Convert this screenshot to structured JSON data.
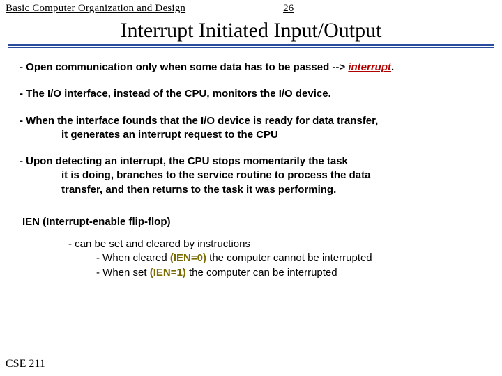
{
  "header": {
    "course_topic": "Basic Computer Organization and Design",
    "page_number": "26"
  },
  "title": "Interrupt Initiated Input/Output",
  "bullets": {
    "b1_pre": "- Open communication only when some data has to be passed --> ",
    "b1_kw": "interrupt",
    "b1_post": ".",
    "b2": "- The I/O interface, instead of the CPU, monitors the I/O device.",
    "b3_l1": "-  When the interface founds that the I/O device is ready for data transfer,",
    "b3_l2": "it generates an interrupt request to the CPU",
    "b4_l1": "-  Upon detecting an interrupt, the CPU stops momentarily the task",
    "b4_l2": "it is doing, branches to the service routine to process the data",
    "b4_l3": "transfer, and then returns to the task it was performing."
  },
  "ien": {
    "heading": "IEN (Interrupt-enable flip-flop)",
    "s1": "- can be set and cleared by instructions",
    "s2_pre": "- When cleared ",
    "s2_val": "(IEN=0)",
    "s2_post": " the computer cannot be interrupted",
    "s3_pre": "- When set ",
    "s3_val": "(IEN=1)",
    "s3_post": " the computer can be interrupted"
  },
  "footer": "CSE 211"
}
